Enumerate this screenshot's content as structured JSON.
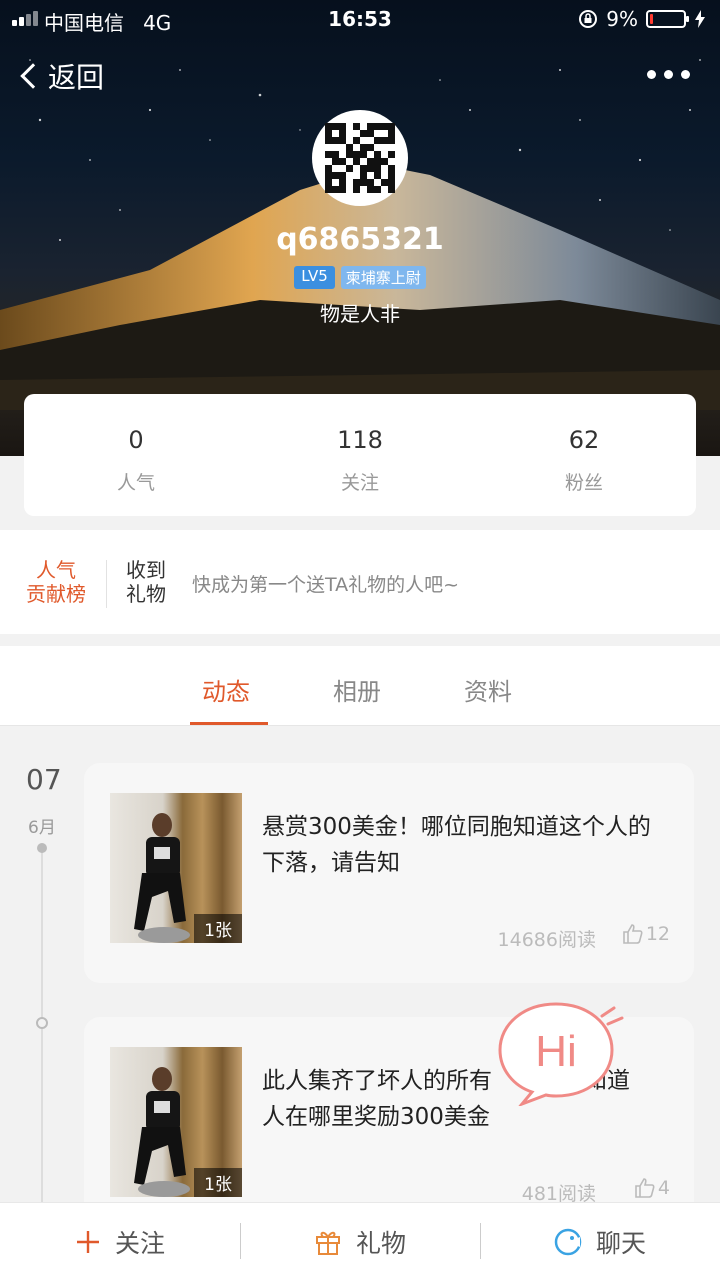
{
  "status_bar": {
    "carrier": "中国电信",
    "network": "4G",
    "time": "16:53",
    "battery": "9%",
    "battery_level": 0.09
  },
  "nav": {
    "back_label": "返回",
    "more_icon": "more-dots-icon"
  },
  "profile": {
    "username": "q6865321",
    "level": "LV5",
    "title_badge": "柬埔寨上尉",
    "motto": "物是人非"
  },
  "stats": [
    {
      "value": "0",
      "label": "人气"
    },
    {
      "value": "118",
      "label": "关注"
    },
    {
      "value": "62",
      "label": "粉丝"
    }
  ],
  "contribution": {
    "rank_line1": "人气",
    "rank_line2": "贡献榜",
    "gift_line1": "收到",
    "gift_line2": "礼物",
    "hint": "快成为第一个送TA礼物的人吧~"
  },
  "tabs": [
    {
      "label": "动态",
      "active": true
    },
    {
      "label": "相册",
      "active": false
    },
    {
      "label": "资料",
      "active": false
    }
  ],
  "feed": {
    "date_day": "07",
    "date_month": "6月",
    "posts": [
      {
        "text": "悬赏300美金！哪位同胞知道这个人的下落，请告知",
        "image_count": "1张",
        "reads": "14686阅读",
        "likes": "12"
      },
      {
        "text": "此人集齐了坏人的所有…知道人在哪里奖励300美金",
        "text_line1": "此人集齐了坏人的所有",
        "text_line1_end": "知道",
        "text_line2": "人在哪里奖励300美金",
        "image_count": "1张",
        "reads": "481阅读",
        "likes": "4"
      }
    ]
  },
  "hi_bubble": "Hi",
  "bottom_bar": {
    "follow": "关注",
    "gift": "礼物",
    "chat": "聊天"
  },
  "colors": {
    "accent": "#e0592b",
    "level_badge": "#3b8fe0",
    "chat_icon": "#3aa3e3"
  }
}
